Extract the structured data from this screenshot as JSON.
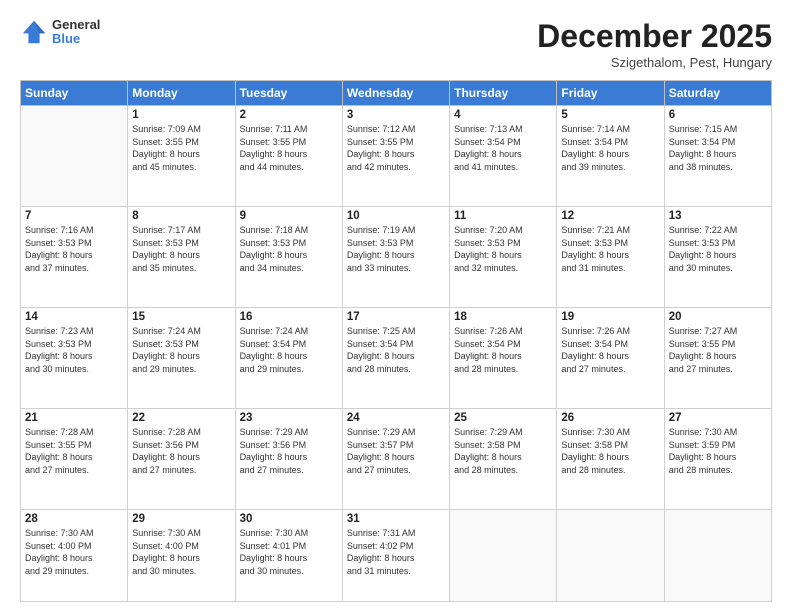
{
  "header": {
    "logo_line1": "General",
    "logo_line2": "Blue",
    "month_title": "December 2025",
    "subtitle": "Szigethalom, Pest, Hungary"
  },
  "weekdays": [
    "Sunday",
    "Monday",
    "Tuesday",
    "Wednesday",
    "Thursday",
    "Friday",
    "Saturday"
  ],
  "weeks": [
    [
      {
        "day": "",
        "info": ""
      },
      {
        "day": "1",
        "info": "Sunrise: 7:09 AM\nSunset: 3:55 PM\nDaylight: 8 hours\nand 45 minutes."
      },
      {
        "day": "2",
        "info": "Sunrise: 7:11 AM\nSunset: 3:55 PM\nDaylight: 8 hours\nand 44 minutes."
      },
      {
        "day": "3",
        "info": "Sunrise: 7:12 AM\nSunset: 3:55 PM\nDaylight: 8 hours\nand 42 minutes."
      },
      {
        "day": "4",
        "info": "Sunrise: 7:13 AM\nSunset: 3:54 PM\nDaylight: 8 hours\nand 41 minutes."
      },
      {
        "day": "5",
        "info": "Sunrise: 7:14 AM\nSunset: 3:54 PM\nDaylight: 8 hours\nand 39 minutes."
      },
      {
        "day": "6",
        "info": "Sunrise: 7:15 AM\nSunset: 3:54 PM\nDaylight: 8 hours\nand 38 minutes."
      }
    ],
    [
      {
        "day": "7",
        "info": "Sunrise: 7:16 AM\nSunset: 3:53 PM\nDaylight: 8 hours\nand 37 minutes."
      },
      {
        "day": "8",
        "info": "Sunrise: 7:17 AM\nSunset: 3:53 PM\nDaylight: 8 hours\nand 35 minutes."
      },
      {
        "day": "9",
        "info": "Sunrise: 7:18 AM\nSunset: 3:53 PM\nDaylight: 8 hours\nand 34 minutes."
      },
      {
        "day": "10",
        "info": "Sunrise: 7:19 AM\nSunset: 3:53 PM\nDaylight: 8 hours\nand 33 minutes."
      },
      {
        "day": "11",
        "info": "Sunrise: 7:20 AM\nSunset: 3:53 PM\nDaylight: 8 hours\nand 32 minutes."
      },
      {
        "day": "12",
        "info": "Sunrise: 7:21 AM\nSunset: 3:53 PM\nDaylight: 8 hours\nand 31 minutes."
      },
      {
        "day": "13",
        "info": "Sunrise: 7:22 AM\nSunset: 3:53 PM\nDaylight: 8 hours\nand 30 minutes."
      }
    ],
    [
      {
        "day": "14",
        "info": "Sunrise: 7:23 AM\nSunset: 3:53 PM\nDaylight: 8 hours\nand 30 minutes."
      },
      {
        "day": "15",
        "info": "Sunrise: 7:24 AM\nSunset: 3:53 PM\nDaylight: 8 hours\nand 29 minutes."
      },
      {
        "day": "16",
        "info": "Sunrise: 7:24 AM\nSunset: 3:54 PM\nDaylight: 8 hours\nand 29 minutes."
      },
      {
        "day": "17",
        "info": "Sunrise: 7:25 AM\nSunset: 3:54 PM\nDaylight: 8 hours\nand 28 minutes."
      },
      {
        "day": "18",
        "info": "Sunrise: 7:26 AM\nSunset: 3:54 PM\nDaylight: 8 hours\nand 28 minutes."
      },
      {
        "day": "19",
        "info": "Sunrise: 7:26 AM\nSunset: 3:54 PM\nDaylight: 8 hours\nand 27 minutes."
      },
      {
        "day": "20",
        "info": "Sunrise: 7:27 AM\nSunset: 3:55 PM\nDaylight: 8 hours\nand 27 minutes."
      }
    ],
    [
      {
        "day": "21",
        "info": "Sunrise: 7:28 AM\nSunset: 3:55 PM\nDaylight: 8 hours\nand 27 minutes."
      },
      {
        "day": "22",
        "info": "Sunrise: 7:28 AM\nSunset: 3:56 PM\nDaylight: 8 hours\nand 27 minutes."
      },
      {
        "day": "23",
        "info": "Sunrise: 7:29 AM\nSunset: 3:56 PM\nDaylight: 8 hours\nand 27 minutes."
      },
      {
        "day": "24",
        "info": "Sunrise: 7:29 AM\nSunset: 3:57 PM\nDaylight: 8 hours\nand 27 minutes."
      },
      {
        "day": "25",
        "info": "Sunrise: 7:29 AM\nSunset: 3:58 PM\nDaylight: 8 hours\nand 28 minutes."
      },
      {
        "day": "26",
        "info": "Sunrise: 7:30 AM\nSunset: 3:58 PM\nDaylight: 8 hours\nand 28 minutes."
      },
      {
        "day": "27",
        "info": "Sunrise: 7:30 AM\nSunset: 3:59 PM\nDaylight: 8 hours\nand 28 minutes."
      }
    ],
    [
      {
        "day": "28",
        "info": "Sunrise: 7:30 AM\nSunset: 4:00 PM\nDaylight: 8 hours\nand 29 minutes."
      },
      {
        "day": "29",
        "info": "Sunrise: 7:30 AM\nSunset: 4:00 PM\nDaylight: 8 hours\nand 30 minutes."
      },
      {
        "day": "30",
        "info": "Sunrise: 7:30 AM\nSunset: 4:01 PM\nDaylight: 8 hours\nand 30 minutes."
      },
      {
        "day": "31",
        "info": "Sunrise: 7:31 AM\nSunset: 4:02 PM\nDaylight: 8 hours\nand 31 minutes."
      },
      {
        "day": "",
        "info": ""
      },
      {
        "day": "",
        "info": ""
      },
      {
        "day": "",
        "info": ""
      }
    ]
  ]
}
